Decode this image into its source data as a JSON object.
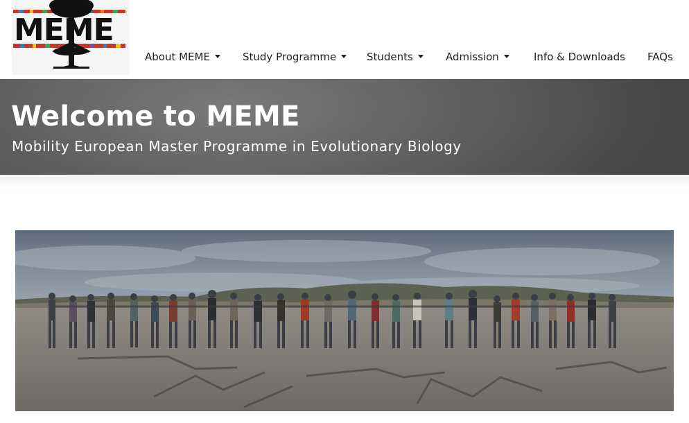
{
  "logo": {
    "text": "MEME",
    "icon": "tree-logo-icon"
  },
  "nav": {
    "items": [
      {
        "label": "About MEME",
        "has_dropdown": true
      },
      {
        "label": "Study Programme",
        "has_dropdown": true
      },
      {
        "label": "Students",
        "has_dropdown": true
      },
      {
        "label": "Admission",
        "has_dropdown": true
      },
      {
        "label": "Info & Downloads",
        "has_dropdown": false
      },
      {
        "label": "FAQs",
        "has_dropdown": false
      }
    ]
  },
  "hero": {
    "title": "Welcome to MEME",
    "subtitle": "Mobility European Master Programme in Evolutionary Biology"
  },
  "photo": {
    "subject": "group-photo-beach"
  },
  "colors": {
    "hero_bg": "#5f5f5f",
    "text_dark": "#222222",
    "white": "#ffffff"
  }
}
